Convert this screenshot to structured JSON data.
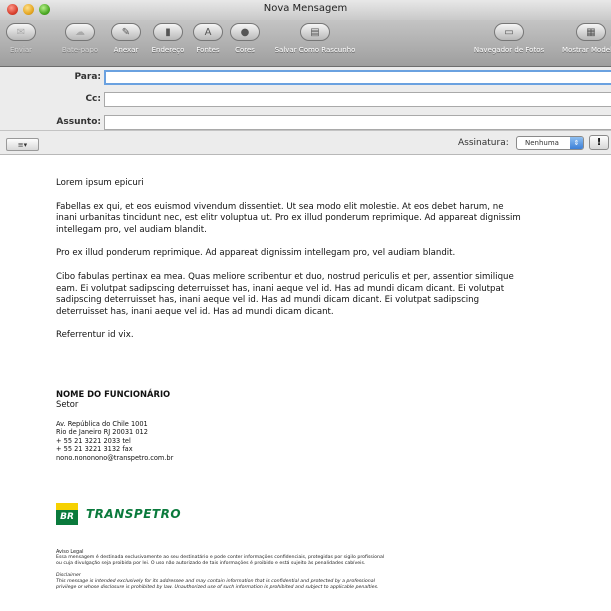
{
  "window": {
    "title": "Nova Mensagem"
  },
  "toolbar": {
    "items": [
      {
        "label": "Enviar",
        "icon": "send-icon",
        "glyph": "✉",
        "disabled": true
      },
      {
        "label": "Bate-papo",
        "icon": "chat-icon",
        "glyph": "☁",
        "disabled": true
      },
      {
        "label": "Anexar",
        "icon": "attach-icon",
        "glyph": "✎",
        "disabled": false
      },
      {
        "label": "Endereço",
        "icon": "address-icon",
        "glyph": "▮",
        "disabled": false
      },
      {
        "label": "Fontes",
        "icon": "fonts-icon",
        "glyph": "A",
        "disabled": false
      },
      {
        "label": "Cores",
        "icon": "colors-icon",
        "glyph": "●",
        "disabled": false
      },
      {
        "label": "Salvar Como Rascunho",
        "icon": "save-draft-icon",
        "glyph": "▤",
        "disabled": false
      },
      {
        "label": "Navegador de Fotos",
        "icon": "photo-browser-icon",
        "glyph": "▭",
        "disabled": false
      },
      {
        "label": "Mostrar Modelos",
        "icon": "stationery-icon",
        "glyph": "▦",
        "disabled": false
      }
    ]
  },
  "headers": {
    "to_label": "Para:",
    "to_value": "",
    "cc_label": "Cc:",
    "cc_value": "",
    "subject_label": "Assunto:",
    "subject_value": "",
    "format_button": "≡▾",
    "signature_label": "Assinatura:",
    "signature_value": "Nenhuma",
    "priority_label": "!"
  },
  "message": {
    "paragraphs": [
      "Lorem ipsum epicuri",
      "Fabellas ex qui, et eos euismod vivendum dissentiet. Ut sea modo elit molestie. At eos debet harum, ne inani urbanitas tincidunt nec, est elitr voluptua ut. Pro ex illud ponderum reprimique. Ad appareat dignissim intellegam pro, vel audiam blandit.",
      "Pro ex illud ponderum reprimique. Ad appareat dignissim intellegam pro, vel audiam blandit.",
      "Cibo fabulas pertinax ea mea. Quas meliore scribentur et duo, nostrud periculis et per, assentior similique eam. Ei volutpat sadipscing deterruisset has, inani aeque vel id. Has ad mundi dicam dicant. Ei volutpat sadipscing deterruisset has, inani aeque vel id. Has ad mundi dicam dicant. Ei volutpat sadipscing deterruisset has, inani aeque vel id. Has ad mundi dicam dicant.",
      "Referrentur id vix."
    ]
  },
  "signature": {
    "name": "NOME DO FUNCIONÁRIO",
    "sector": "Setor",
    "address_lines": [
      "Av. República do Chile 1001",
      "Rio de Janeiro  RJ  20031 012",
      "+ 55  21  3221  2033  tel",
      "+ 55  21  3221  3132  fax",
      "nono.nononono@transpetro.com.br"
    ],
    "logo_mark": "BR",
    "logo_text": "TRANSPETRO",
    "legal_title": "Aviso Legal",
    "legal_text_1": "Essa mensagem é destinada exclusivamente ao seu destinatário e pode conter informações confidenciais, protegidas por sigilo profissional",
    "legal_text_2": "ou cuja divulgação seja proibida por lei. O uso não autorizado de tais informações é proibido e está sujeito às penalidades cabíveis.",
    "disclaimer_title": "Disclaimer",
    "disclaimer_text_1": "This message is intended exclusively for its addressee and may contain information that is confidential and protected by a professional",
    "disclaimer_text_2": "privilege or whose disclosure is prohibited by law. Unauthorized use of such information is prohibited and subject to applicable penalties."
  },
  "colors": {
    "logo_green": "#0a7a3c",
    "logo_yellow": "#f6d100",
    "focus_ring": "#6aa1e0",
    "select_arrow": "#3c7fd6"
  }
}
